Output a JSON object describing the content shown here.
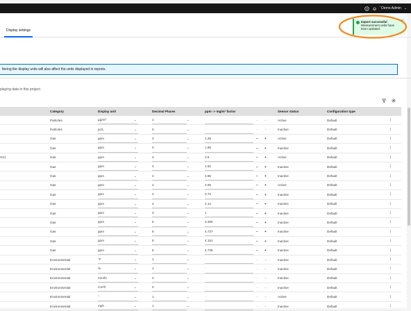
{
  "topbar": {
    "user_label": "' Demo Admin",
    "chevron": "⌄"
  },
  "tabs": [
    {
      "label": "Display settings"
    }
  ],
  "banner": {
    "text": "ltering the display units will also affect the units displayed in reports."
  },
  "description": "playing data in this project.",
  "toast": {
    "title": "Import successful",
    "message": "Measurement units have been updated.",
    "close": "×"
  },
  "table": {
    "headers": {
      "category": "Category",
      "unit": "Display unit",
      "decimals": "Decimal Places",
      "factor": "ppm -> mg/m³ factor",
      "status": "Sensor status",
      "config": "Configuration type"
    },
    "rows": [
      {
        "name": "",
        "category": "Particles",
        "unit": "μg/m³",
        "decimals": "1",
        "factor": "-",
        "status": "Active",
        "config": "Default",
        "factor_enabled": false
      },
      {
        "name": "",
        "category": "Particles",
        "unit": "pc/L",
        "decimals": "0",
        "factor": "-",
        "status": "Inactive",
        "config": "Default",
        "factor_enabled": false
      },
      {
        "name": "",
        "category": "Gas",
        "unit": "ppm",
        "decimals": "3",
        "factor": "1.25",
        "status": "Active",
        "config": "Default",
        "factor_enabled": true
      },
      {
        "name": "",
        "category": "Gas",
        "unit": "ppm",
        "decimals": "0",
        "factor": "1.96",
        "status": "Inactive",
        "config": "Default",
        "factor_enabled": true
      },
      {
        "name": "OC)",
        "category": "Gas",
        "unit": "ppm",
        "decimals": "4",
        "factor": "2.5",
        "status": "Active",
        "config": "Default",
        "factor_enabled": true
      },
      {
        "name": "",
        "category": "Gas",
        "unit": "ppm",
        "decimals": "4",
        "factor": "1.92",
        "status": "Inactive",
        "config": "Default",
        "factor_enabled": true
      },
      {
        "name": "",
        "category": "Gas",
        "unit": "ppm",
        "decimals": "4",
        "factor": "2.86",
        "status": "Inactive",
        "config": "Default",
        "factor_enabled": true
      },
      {
        "name": "",
        "category": "Gas",
        "unit": "ppm",
        "decimals": "4",
        "factor": "2.05",
        "status": "Active",
        "config": "Default",
        "factor_enabled": true
      },
      {
        "name": "",
        "category": "Gas",
        "unit": "ppm",
        "decimals": "2",
        "factor": "0.72",
        "status": "Inactive",
        "config": "Default",
        "factor_enabled": true
      },
      {
        "name": "",
        "category": "Gas",
        "unit": "ppm",
        "decimals": "4",
        "factor": "2.14",
        "status": "Inactive",
        "config": "Default",
        "factor_enabled": true
      },
      {
        "name": "",
        "category": "Gas",
        "unit": "ppm",
        "decimals": "4",
        "factor": "1",
        "status": "Inactive",
        "config": "Default",
        "factor_enabled": true
      },
      {
        "name": "",
        "category": "Gas",
        "unit": "ppm",
        "decimals": "5",
        "factor": "3.485",
        "status": "Inactive",
        "config": "Default",
        "factor_enabled": true
      },
      {
        "name": "",
        "category": "Gas",
        "unit": "ppm",
        "decimals": "5",
        "factor": "4.737",
        "status": "Inactive",
        "config": "Default",
        "factor_enabled": true
      },
      {
        "name": "",
        "category": "Gas",
        "unit": "ppm",
        "decimals": "5",
        "factor": "4.151",
        "status": "Inactive",
        "config": "Default",
        "factor_enabled": true
      },
      {
        "name": "",
        "category": "Gas",
        "unit": "ppm",
        "decimals": "5",
        "factor": "4.736",
        "status": "Inactive",
        "config": "Default",
        "factor_enabled": true
      },
      {
        "name": "",
        "category": "Environmental",
        "unit": "°F",
        "decimals": "1",
        "factor": "-",
        "status": "Inactive",
        "config": "Default",
        "factor_enabled": false
      },
      {
        "name": "",
        "category": "Environmental",
        "unit": "%",
        "decimals": "1",
        "factor": "-",
        "status": "Inactive",
        "config": "Default",
        "factor_enabled": false
      },
      {
        "name": "",
        "category": "Environmental",
        "unit": "mm/hr",
        "decimals": "0",
        "factor": "-",
        "status": "Inactive",
        "config": "Default",
        "factor_enabled": false
      },
      {
        "name": "",
        "category": "Environmental",
        "unit": "/cm²h",
        "decimals": "0",
        "factor": "-",
        "status": "Inactive",
        "config": "Default",
        "factor_enabled": false
      },
      {
        "name": "",
        "category": "Environmental",
        "unit": "°",
        "decimals": "1",
        "factor": "-",
        "status": "Active",
        "config": "Default",
        "factor_enabled": false
      },
      {
        "name": "",
        "category": "Environmental",
        "unit": "mph",
        "decimals": "1",
        "factor": "-",
        "status": "Inactive",
        "config": "Default",
        "factor_enabled": false
      }
    ]
  },
  "glyphs": {
    "minus": "−",
    "plus": "+",
    "menu": "⋮",
    "chevron": "⌄"
  },
  "colors": {
    "accent": "#0f62fe",
    "success": "#24a148",
    "annotation": "#f18a1c",
    "banner_border": "#0072c3"
  }
}
